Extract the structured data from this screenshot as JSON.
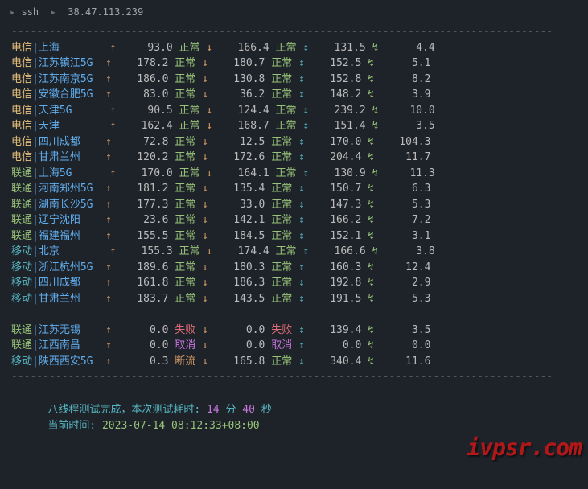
{
  "title": {
    "prefix": "▸",
    "cmd": "ssh",
    "sep": "▸",
    "host": "38.47.113.239"
  },
  "divider_char": "-",
  "isp_labels": {
    "telecom": "电信",
    "unicom": "联通",
    "mobile": "移动"
  },
  "status_labels": {
    "ok": "正常",
    "fail": "失败",
    "cancel": "取消",
    "limit": "断流"
  },
  "rows": [
    {
      "isp": "telecom",
      "loc": "上海",
      "v1": "93.0",
      "s1": "ok",
      "v2": "166.4",
      "s2": "ok",
      "v3": "131.5",
      "v4": "4.4"
    },
    {
      "isp": "telecom",
      "loc": "江苏镇江5G",
      "v1": "178.2",
      "s1": "ok",
      "v2": "180.7",
      "s2": "ok",
      "v3": "152.5",
      "v4": "5.1"
    },
    {
      "isp": "telecom",
      "loc": "江苏南京5G",
      "v1": "186.0",
      "s1": "ok",
      "v2": "130.8",
      "s2": "ok",
      "v3": "152.8",
      "v4": "8.2"
    },
    {
      "isp": "telecom",
      "loc": "安徽合肥5G",
      "v1": "83.0",
      "s1": "ok",
      "v2": "36.2",
      "s2": "ok",
      "v3": "148.2",
      "v4": "3.9"
    },
    {
      "isp": "telecom",
      "loc": "天津5G",
      "v1": "90.5",
      "s1": "ok",
      "v2": "124.4",
      "s2": "ok",
      "v3": "239.2",
      "v4": "10.0"
    },
    {
      "isp": "telecom",
      "loc": "天津",
      "v1": "162.4",
      "s1": "ok",
      "v2": "168.7",
      "s2": "ok",
      "v3": "151.4",
      "v4": "3.5"
    },
    {
      "isp": "telecom",
      "loc": "四川成都",
      "v1": "72.8",
      "s1": "ok",
      "v2": "12.5",
      "s2": "ok",
      "v3": "170.0",
      "v4": "104.3"
    },
    {
      "isp": "telecom",
      "loc": "甘肃兰州",
      "v1": "120.2",
      "s1": "ok",
      "v2": "172.6",
      "s2": "ok",
      "v3": "204.4",
      "v4": "11.7"
    },
    {
      "isp": "unicom",
      "loc": "上海5G",
      "v1": "170.0",
      "s1": "ok",
      "v2": "164.1",
      "s2": "ok",
      "v3": "130.9",
      "v4": "11.3"
    },
    {
      "isp": "unicom",
      "loc": "河南郑州5G",
      "v1": "181.2",
      "s1": "ok",
      "v2": "135.4",
      "s2": "ok",
      "v3": "150.7",
      "v4": "6.3"
    },
    {
      "isp": "unicom",
      "loc": "湖南长沙5G",
      "v1": "177.3",
      "s1": "ok",
      "v2": "33.0",
      "s2": "ok",
      "v3": "147.3",
      "v4": "5.3"
    },
    {
      "isp": "unicom",
      "loc": "辽宁沈阳",
      "v1": "23.6",
      "s1": "ok",
      "v2": "142.1",
      "s2": "ok",
      "v3": "166.2",
      "v4": "7.2"
    },
    {
      "isp": "unicom",
      "loc": "福建福州",
      "v1": "155.5",
      "s1": "ok",
      "v2": "184.5",
      "s2": "ok",
      "v3": "152.1",
      "v4": "3.1"
    },
    {
      "isp": "mobile",
      "loc": "北京",
      "v1": "155.3",
      "s1": "ok",
      "v2": "174.4",
      "s2": "ok",
      "v3": "166.6",
      "v4": "3.8"
    },
    {
      "isp": "mobile",
      "loc": "浙江杭州5G",
      "v1": "189.6",
      "s1": "ok",
      "v2": "180.3",
      "s2": "ok",
      "v3": "160.3",
      "v4": "12.4"
    },
    {
      "isp": "mobile",
      "loc": "四川成都",
      "v1": "161.8",
      "s1": "ok",
      "v2": "186.3",
      "s2": "ok",
      "v3": "192.8",
      "v4": "2.9"
    },
    {
      "isp": "mobile",
      "loc": "甘肃兰州",
      "v1": "183.7",
      "s1": "ok",
      "v2": "143.5",
      "s2": "ok",
      "v3": "191.5",
      "v4": "5.3"
    }
  ],
  "rows2": [
    {
      "isp": "unicom",
      "loc": "江苏无锡",
      "v1": "0.0",
      "s1": "fail",
      "v2": "0.0",
      "s2": "fail",
      "v3": "139.4",
      "v4": "3.5"
    },
    {
      "isp": "unicom",
      "loc": "江西南昌",
      "v1": "0.0",
      "s1": "cancel",
      "v2": "0.0",
      "s2": "cancel",
      "v3": "0.0",
      "v4": "0.0"
    },
    {
      "isp": "mobile",
      "loc": "陕西西安5G",
      "v1": "0.3",
      "s1": "limit",
      "v2": "165.8",
      "s2": "ok",
      "v3": "340.4",
      "v4": "11.6"
    }
  ],
  "summary": {
    "line1_prefix": "八线程测试完成，本次测试耗时:",
    "min": "14",
    "min_unit": "分",
    "sec": "40",
    "sec_unit": "秒",
    "line2_prefix": "当前时间:",
    "timestamp": "2023-07-14 08:12:33+08:00"
  },
  "watermark": "ivpsr.com"
}
